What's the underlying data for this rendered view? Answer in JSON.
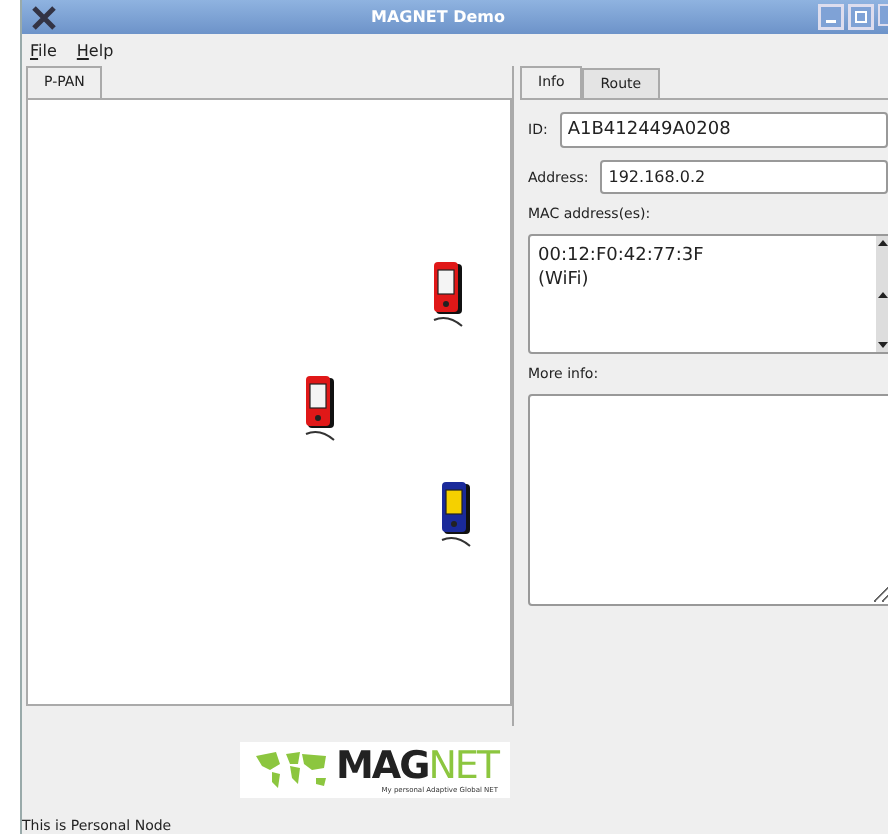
{
  "window": {
    "title": "MAGNET Demo"
  },
  "menu": [
    {
      "label": "File"
    },
    {
      "label": "Help"
    }
  ],
  "left_tabs": [
    {
      "label": "P-PAN",
      "selected": true
    }
  ],
  "devices": [
    {
      "kind": "pda",
      "color": "#e01818"
    },
    {
      "kind": "pda",
      "color": "#e01818"
    },
    {
      "kind": "pda",
      "color": "#1a2a9a"
    }
  ],
  "right_tabs": [
    {
      "label": "Info",
      "selected": true
    },
    {
      "label": "Route",
      "selected": false
    }
  ],
  "info": {
    "id_label": "ID:",
    "id_value": "A1B412449A0208",
    "address_label": "Address:",
    "address_value": "192.168.0.2",
    "mac_label": "MAC address(es):",
    "mac_lines": [
      "00:12:F0:42:77:3F",
      "(WiFi)"
    ],
    "more_label": "More info:"
  },
  "logo": {
    "part_1": "MAG",
    "part_2": "NET",
    "tagline": "My personal Adaptive Global NET"
  },
  "status_bar": "This is Personal Node"
}
